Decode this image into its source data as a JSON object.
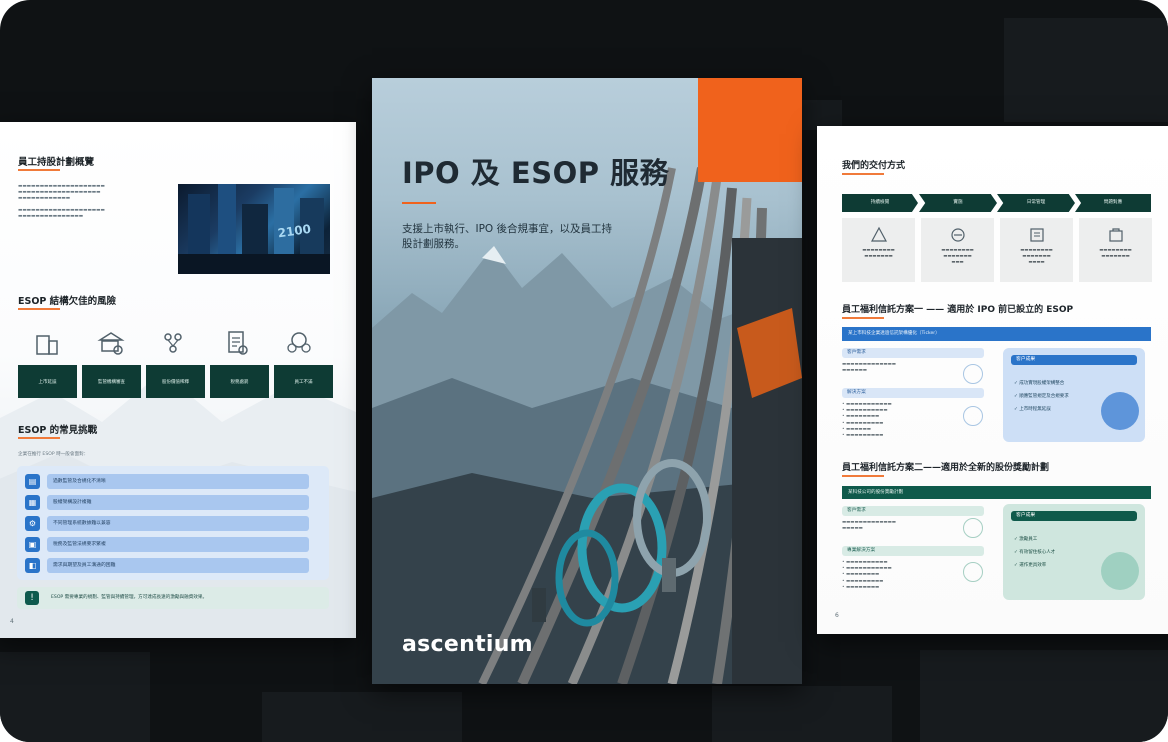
{
  "left": {
    "overview_title": "員工持股計劃概覽",
    "risks_title": "ESOP 結構欠佳的風險",
    "risks": [
      "上市延誤",
      "監管機構審查",
      "股份價值稀釋",
      "稅務處罰",
      "員工不滿"
    ],
    "challenges_title": "ESOP 的常見挑戰",
    "challenges_intro": "企業在推行 ESOP 時一般會面對：",
    "challenges": [
      "過數監管及合規化不清晰",
      "股權架構設計複雜",
      "不同管理系統數據難以兼容",
      "稅務及監管法規要求繁複",
      "需求與期望及員工溝通的困難"
    ],
    "note": "ESOP 需要專業的規劃、監管與持續管理，方可達成長遠的激勵與融資效果。",
    "page_number": "4"
  },
  "cover": {
    "title": "IPO 及 ESOP 服務",
    "subtitle": "支援上市執行、IPO 後合規事宜，以及員工持股計劃服務。",
    "logo_text": "ascentium"
  },
  "right": {
    "delivery_title": "我們的交付方式",
    "steps": [
      "持續檢閱",
      "實施",
      "日常管理",
      "問題對應"
    ],
    "solution1_title": "員工福利信託方案一 —— 適用於 IPO 前已設立的 ESOP",
    "solution1_banner": "某上市科技企業透過信託架構優化（Ticker）",
    "solution1_left": [
      "客戶需求",
      "解決方案"
    ],
    "solution1_case_title": "客户成果",
    "solution1_results": [
      "成功實現股權架構整合",
      "順應監管規定及合規要求",
      "上市時程無延誤"
    ],
    "solution2_title": "員工福利信託方案二——適用於全新的股份獎勵計劃",
    "solution2_banner": "某科技公司的股份獎勵計劃",
    "solution2_left": [
      "客戶需求",
      "專業解決方案"
    ],
    "solution2_case_title": "客户成果",
    "solution2_results": [
      "激勵員工",
      "有效留住核心人才",
      "運作更具效率"
    ],
    "page_number": "6"
  },
  "colors": {
    "accent_orange": "#f0621c",
    "dark_green": "#0e3b34",
    "blue": "#2a74c9"
  }
}
